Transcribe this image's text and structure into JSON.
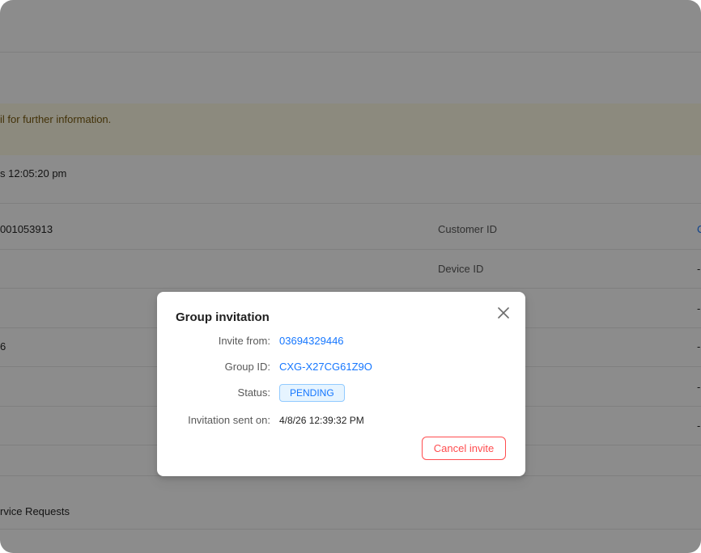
{
  "background": {
    "warning_text": "il for further information.",
    "timestamp_text": "s 12:05:20 pm",
    "row_value_1": "001053913",
    "row_value_2": "6",
    "service_requests_text": "rvice Requests",
    "labels": {
      "customer_id": "Customer ID",
      "device_id": "Device ID"
    },
    "edge_values": [
      "C",
      "-",
      "-",
      "-",
      "-",
      "-"
    ]
  },
  "modal": {
    "title": "Group invitation",
    "close_icon": "close-icon",
    "fields": {
      "invite_from_label": "Invite from:",
      "invite_from_value": "03694329446",
      "group_id_label": "Group ID:",
      "group_id_value": "CXG-X27CG61Z9O",
      "status_label": "Status:",
      "status_value": "PENDING",
      "sent_on_label": "Invitation sent on:",
      "sent_on_value": "4/8/26 12:39:32 PM"
    },
    "cancel_button_label": "Cancel invite"
  },
  "colors": {
    "link": "#1677ff",
    "danger": "#ff4d4f",
    "overlay": "rgba(0,0,0,0.45)",
    "warning_bg": "#fffbe6"
  }
}
